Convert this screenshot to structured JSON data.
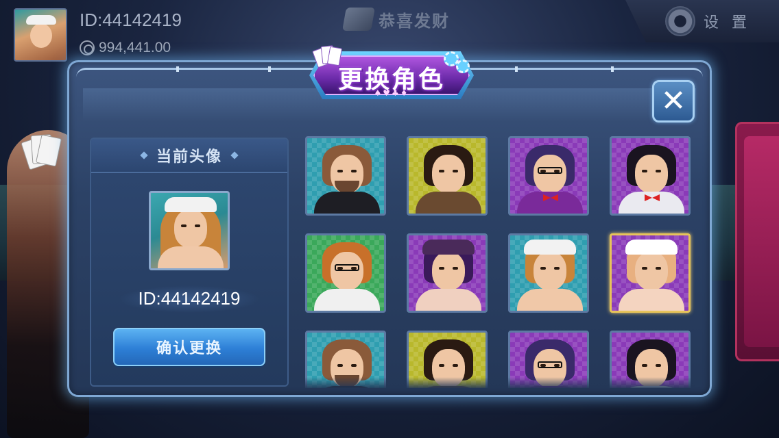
{
  "header": {
    "player_id": "ID:44142419",
    "coins": "994,441.00",
    "brand": "恭喜发财",
    "settings_label": "设 置"
  },
  "dialog": {
    "title": "更换角色",
    "title_suits": "♠♥♣♦",
    "close_symbol": "✕",
    "current_panel": {
      "title": "当前头像",
      "avatar_id": "ID:44142419",
      "confirm_label": "确认更换"
    },
    "avatars": [
      {
        "name": "bearded-man",
        "bg": "#2f9eb0",
        "hair": "#8a5a3a",
        "body": "#1e1e24",
        "beard": true,
        "glasses": false,
        "bow": false,
        "hat": false,
        "selected": false
      },
      {
        "name": "man-mandarin-collar",
        "bg": "#b9b82c",
        "hair": "#2a1a12",
        "body": "#6a4a30",
        "beard": false,
        "glasses": false,
        "bow": false,
        "hat": false,
        "selected": false
      },
      {
        "name": "man-glasses-cigar",
        "bg": "#8a3ab8",
        "hair": "#3a2a6a",
        "body": "#7a2a9a",
        "beard": false,
        "glasses": true,
        "bow": true,
        "hat": false,
        "selected": false
      },
      {
        "name": "man-tuxedo",
        "bg": "#8a3ab8",
        "hair": "#1a1420",
        "body": "#eaeaf0",
        "beard": false,
        "glasses": false,
        "bow": true,
        "hat": false,
        "selected": false
      },
      {
        "name": "woman-glasses",
        "bg": "#3aa85a",
        "hair": "#c8702a",
        "body": "#f0f0f0",
        "beard": false,
        "glasses": true,
        "bow": false,
        "hat": false,
        "selected": false
      },
      {
        "name": "woman-officer-cap",
        "bg": "#8a3ab8",
        "hair": "#3a1a5a",
        "body": "#f0d0c0",
        "beard": false,
        "glasses": false,
        "bow": false,
        "hat": true,
        "hat_color": "#4a2a5a",
        "selected": false
      },
      {
        "name": "woman-sailor-hat",
        "bg": "#2f9eb0",
        "hair": "#c8843a",
        "body": "#f0c8a8",
        "beard": false,
        "glasses": false,
        "bow": false,
        "hat": true,
        "hat_color": "#f2f2f2",
        "selected": false
      },
      {
        "name": "woman-nurse",
        "bg": "#8a3ab8",
        "hair": "#e8b080",
        "body": "#f4d4c0",
        "beard": false,
        "glasses": false,
        "bow": false,
        "hat": true,
        "hat_color": "#ffffff",
        "selected": true
      },
      {
        "name": "bearded-man-2",
        "bg": "#2f9eb0",
        "hair": "#8a5a3a",
        "body": "#1e1e24",
        "beard": true,
        "glasses": false,
        "bow": false,
        "hat": false,
        "selected": false
      },
      {
        "name": "man-mandarin-collar-2",
        "bg": "#b9b82c",
        "hair": "#2a1a12",
        "body": "#6a4a30",
        "beard": false,
        "glasses": false,
        "bow": false,
        "hat": false,
        "selected": false
      },
      {
        "name": "man-glasses-cigar-2",
        "bg": "#8a3ab8",
        "hair": "#3a2a6a",
        "body": "#7a2a9a",
        "beard": false,
        "glasses": true,
        "bow": true,
        "hat": false,
        "selected": false
      },
      {
        "name": "man-tuxedo-2",
        "bg": "#8a3ab8",
        "hair": "#1a1420",
        "body": "#eaeaf0",
        "beard": false,
        "glasses": false,
        "bow": true,
        "hat": false,
        "selected": false
      }
    ]
  },
  "colors": {
    "accent": "#2d7fd6",
    "selected_border": "#e7c45a",
    "dialog_border": "#7fa8d4",
    "title_purple": "#6a2aa8"
  }
}
